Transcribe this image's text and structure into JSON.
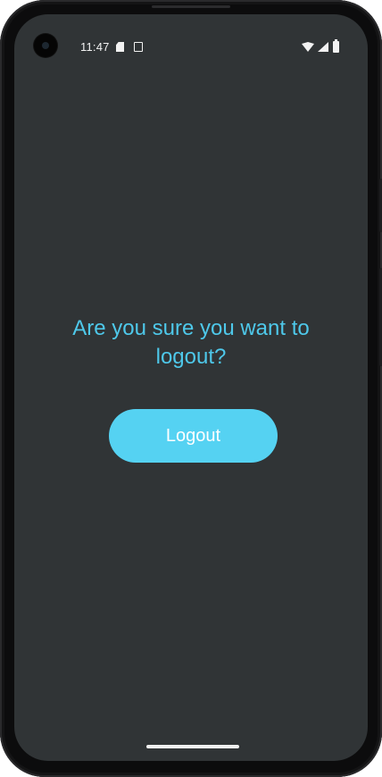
{
  "status_bar": {
    "time": "11:47",
    "left_icons": [
      "sim-card-icon",
      "screenshot-icon"
    ],
    "right_icons": [
      "wifi-icon",
      "signal-icon",
      "battery-icon"
    ]
  },
  "dialog": {
    "question": "Are you sure you want to logout?",
    "logout_label": "Logout"
  },
  "colors": {
    "background": "#303436",
    "accent_text": "#4ec8ea",
    "button": "#55d2f2",
    "button_text": "#ffffff"
  }
}
